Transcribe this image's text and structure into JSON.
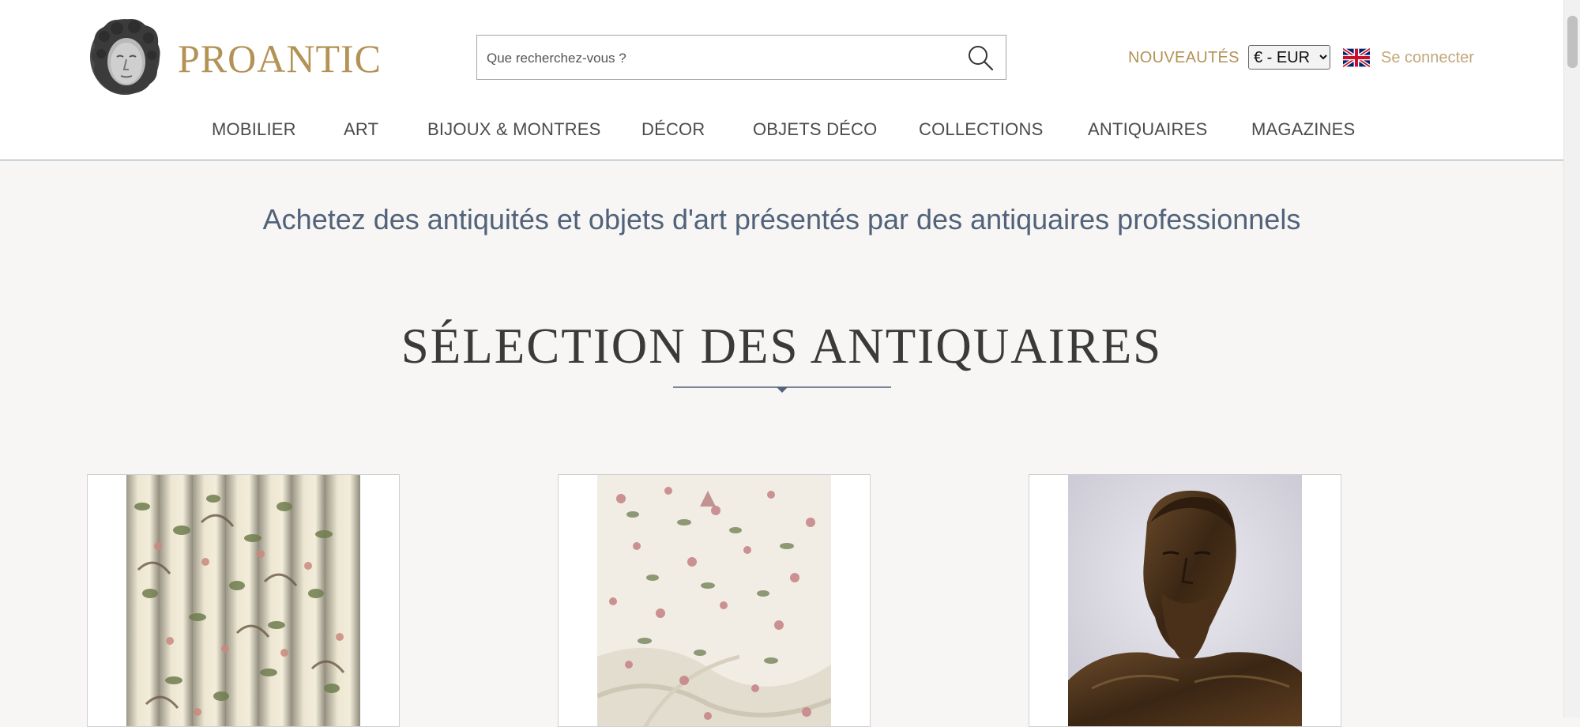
{
  "header": {
    "logo_text": "PROANTIC",
    "search_placeholder": "Que recherchez-vous ?",
    "nouveautes_label": "NOUVEAUTÉS",
    "currency_selected": "€ - EUR",
    "language_flag": "uk-flag-icon",
    "login_label": "Se connecter"
  },
  "nav": {
    "items": [
      {
        "label": "MOBILIER"
      },
      {
        "label": "ART"
      },
      {
        "label": "BIJOUX & MONTRES"
      },
      {
        "label": "DÉCOR"
      },
      {
        "label": "OBJETS DÉCO"
      },
      {
        "label": "COLLECTIONS"
      },
      {
        "label": "ANTIQUAIRES"
      },
      {
        "label": "MAGAZINES"
      }
    ]
  },
  "main": {
    "tagline": "Achetez des antiquités et objets d'art présentés par des antiquaires professionnels",
    "section_title": "SÉLECTION DES ANTIQUAIRES",
    "products": [
      {
        "image": "floral-bird-curtains-photo"
      },
      {
        "image": "floral-fabric-photo"
      },
      {
        "image": "wooden-christ-sculpture-photo"
      }
    ]
  },
  "colors": {
    "brand_gold": "#b39256",
    "tagline_blue": "#51627a",
    "background": "#f7f6f4"
  }
}
